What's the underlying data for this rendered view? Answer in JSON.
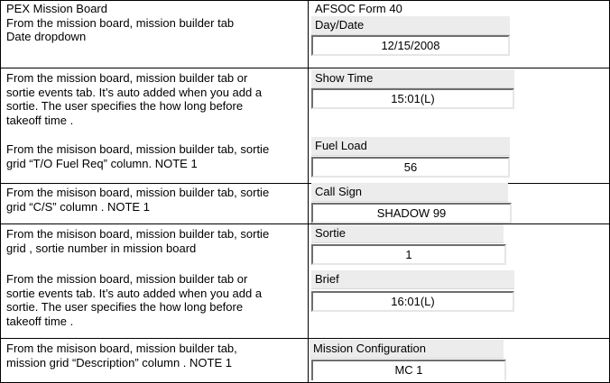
{
  "left_col": {
    "row1": "PEX Mission Board\nFrom the mission board, mission builder tab\nDate dropdown",
    "row2a": "From the mission board, mission builder tab or\nsortie events tab.  It’s auto added when you add a\nsortie.  The user specifies  the how long before\ntakeoff time .",
    "row2b": "From the misison board, mission builder tab, sortie\ngrid  “T/O Fuel Req” column.  NOTE 1",
    "row3": "From the misison board, mission builder tab, sortie\ngrid  “C/S” column . NOTE 1",
    "row4a": "From the misison board, mission builder tab, sortie\ngrid , sortie number in mission board",
    "row4b": "From the mission board, mission builder tab or\nsortie events tab.  It’s auto added when you add a\nsortie.  The user specifies  the how long before\ntakeoff time .",
    "row5": "From the misison board, mission builder tab,\nmission grid “Description” column . NOTE 1"
  },
  "form_title": "AFSOC Form 40",
  "fields": {
    "day_date": {
      "label": "Day/Date",
      "value": "12/15/2008"
    },
    "show_time": {
      "label": "Show Time",
      "value": "15:01(L)"
    },
    "fuel_load": {
      "label": "Fuel Load",
      "value": "56"
    },
    "call_sign": {
      "label": "Call Sign",
      "value": "SHADOW 99"
    },
    "sortie": {
      "label": "Sortie",
      "value": "1"
    },
    "brief": {
      "label": "Brief",
      "value": "16:01(L)"
    },
    "mission_configuration": {
      "label": "Mission Configuration",
      "value": "MC 1"
    }
  }
}
